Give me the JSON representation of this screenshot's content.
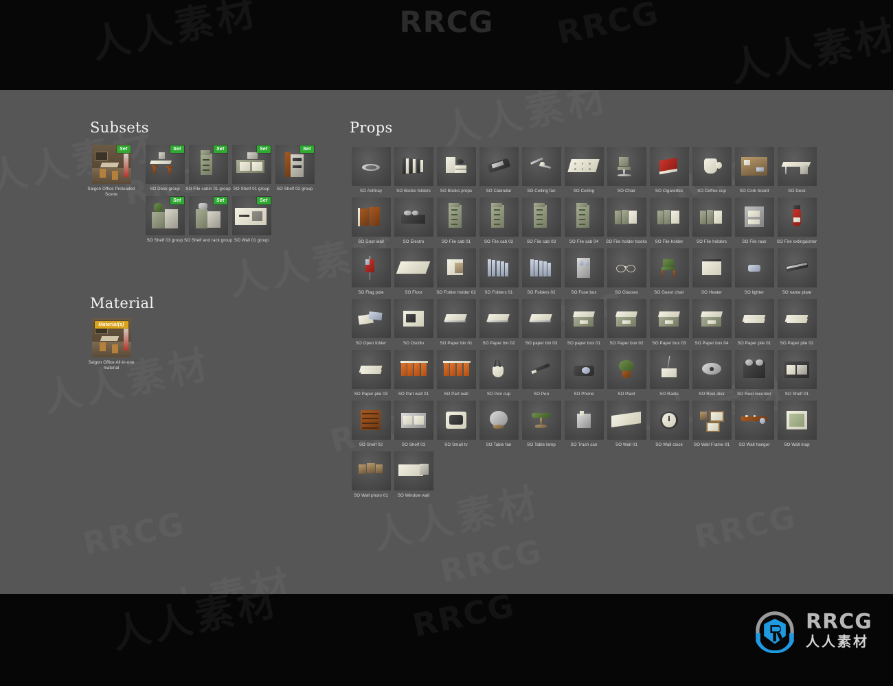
{
  "brand": {
    "top_text": "RRCG",
    "footer_text": "RRCG",
    "footer_cn": "人人素材",
    "logo_icon": "rrcg-shield-logo-icon"
  },
  "watermarks": {
    "cn": "人人素材",
    "en": "RRCG"
  },
  "sections": {
    "subsets": {
      "title": "Subsets",
      "feature": {
        "caption": "Saigon Office Preloaded Scene",
        "badge": "Set"
      },
      "items": [
        {
          "caption": "SO Desk group",
          "badge": "Set"
        },
        {
          "caption": "SO File cabin 01 group",
          "badge": "Set"
        },
        {
          "caption": "SO Shelf 01 group",
          "badge": "Set"
        },
        {
          "caption": "SO Shelf 02 group",
          "badge": "Set"
        },
        {
          "caption": "SO Shelf 03 group",
          "badge": "Set"
        },
        {
          "caption": "SO Shelf and rack group",
          "badge": "Set"
        },
        {
          "caption": "SO Wall 01 group",
          "badge": "Set"
        }
      ]
    },
    "material": {
      "title": "Material",
      "feature": {
        "caption": "Saigon Office All-in-one material",
        "badge": "Material(s)"
      }
    },
    "props": {
      "title": "Props",
      "items": [
        {
          "caption": "SO Ashtray"
        },
        {
          "caption": "SO Books folders"
        },
        {
          "caption": "SO Books props"
        },
        {
          "caption": "SO Calendar"
        },
        {
          "caption": "SO Ceiling fan"
        },
        {
          "caption": "SO Ceiling"
        },
        {
          "caption": "SO Chair"
        },
        {
          "caption": "SO Cigarettes"
        },
        {
          "caption": "SO Coffee cup"
        },
        {
          "caption": "SO Cork board"
        },
        {
          "caption": "SO Desk"
        },
        {
          "caption": "SO Door wall"
        },
        {
          "caption": "SO Electro"
        },
        {
          "caption": "SO File cab 01"
        },
        {
          "caption": "SO File cab 02"
        },
        {
          "caption": "SO File cab 03"
        },
        {
          "caption": "SO File cab 04"
        },
        {
          "caption": "SO File holder books"
        },
        {
          "caption": "SO File holder"
        },
        {
          "caption": "SO File holders"
        },
        {
          "caption": "SO File rack"
        },
        {
          "caption": "SO Fire extinguisher"
        },
        {
          "caption": "SO Flag pole"
        },
        {
          "caption": "SO Floor"
        },
        {
          "caption": "SO Folder holder 02"
        },
        {
          "caption": "SO Folders 01"
        },
        {
          "caption": "SO Folders 02"
        },
        {
          "caption": "SO Fuse box"
        },
        {
          "caption": "SO Glasses"
        },
        {
          "caption": "SO Guest chair"
        },
        {
          "caption": "SO Heater"
        },
        {
          "caption": "SO lighter"
        },
        {
          "caption": "SO name plate"
        },
        {
          "caption": "SO Open folder"
        },
        {
          "caption": "SO Oscillo"
        },
        {
          "caption": "SO Paper bin 01"
        },
        {
          "caption": "SO Paper bin 02"
        },
        {
          "caption": "SO paper bin 03"
        },
        {
          "caption": "SO paper box 01"
        },
        {
          "caption": "SO Paper box 02"
        },
        {
          "caption": "SO Paper box 03"
        },
        {
          "caption": "SO Paper box 04"
        },
        {
          "caption": "SO Paper pile 01"
        },
        {
          "caption": "SO Paper pile 02"
        },
        {
          "caption": "SO Paper pile 03"
        },
        {
          "caption": "SO Part wall 01"
        },
        {
          "caption": "SO Part wall"
        },
        {
          "caption": "SO Pen cup"
        },
        {
          "caption": "SO Pen"
        },
        {
          "caption": "SO Phone"
        },
        {
          "caption": "SO Plant"
        },
        {
          "caption": "SO Radio"
        },
        {
          "caption": "SO Reel disk"
        },
        {
          "caption": "SO Reel recorder"
        },
        {
          "caption": "SO Shelf 01"
        },
        {
          "caption": "SO Shelf 02"
        },
        {
          "caption": "SO Shelf 03"
        },
        {
          "caption": "SO Small tv"
        },
        {
          "caption": "SO Table fan"
        },
        {
          "caption": "SO Table lamp"
        },
        {
          "caption": "SO Trash can"
        },
        {
          "caption": "SO Wall 01"
        },
        {
          "caption": "SO Wall clock"
        },
        {
          "caption": "SO Wall Frame 01"
        },
        {
          "caption": "SO Wall hanger"
        },
        {
          "caption": "SO Wall map"
        },
        {
          "caption": "SO Wall photo 01"
        },
        {
          "caption": "SO Window wall"
        }
      ]
    }
  },
  "colors": {
    "panel_bg": "#565656",
    "banner_bg": "#070707",
    "badge_set": "#2faa31",
    "badge_material": "#d9a31b",
    "logo_blue": "#1f9ae0",
    "text": "#dedede"
  }
}
